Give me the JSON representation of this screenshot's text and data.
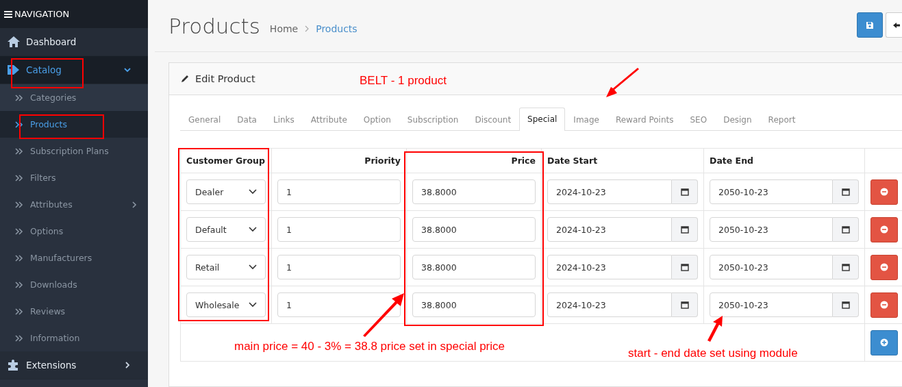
{
  "sidebar": {
    "title": "NAVIGATION",
    "items": [
      {
        "label": "Dashboard",
        "selected": false
      },
      {
        "label": "Catalog",
        "selected": true,
        "expanded": true,
        "children": [
          {
            "label": "Categories",
            "selected": false,
            "has_submenu": false
          },
          {
            "label": "Products",
            "selected": true,
            "has_submenu": false
          },
          {
            "label": "Subscription Plans",
            "selected": false,
            "has_submenu": false
          },
          {
            "label": "Filters",
            "selected": false,
            "has_submenu": false
          },
          {
            "label": "Attributes",
            "selected": false,
            "has_submenu": true
          },
          {
            "label": "Options",
            "selected": false,
            "has_submenu": false
          },
          {
            "label": "Manufacturers",
            "selected": false,
            "has_submenu": false
          },
          {
            "label": "Downloads",
            "selected": false,
            "has_submenu": false
          },
          {
            "label": "Reviews",
            "selected": false,
            "has_submenu": false
          },
          {
            "label": "Information",
            "selected": false,
            "has_submenu": false
          }
        ]
      },
      {
        "label": "Extensions",
        "selected": false,
        "expanded": false
      }
    ]
  },
  "page": {
    "title": "Products",
    "breadcrumb": [
      {
        "label": "Home",
        "selected": false
      },
      {
        "label": "Products",
        "selected": true
      }
    ]
  },
  "panel": {
    "title": "Edit Product"
  },
  "tabs": [
    {
      "label": "General",
      "selected": false
    },
    {
      "label": "Data",
      "selected": false
    },
    {
      "label": "Links",
      "selected": false
    },
    {
      "label": "Attribute",
      "selected": false
    },
    {
      "label": "Option",
      "selected": false
    },
    {
      "label": "Subscription",
      "selected": false
    },
    {
      "label": "Discount",
      "selected": false
    },
    {
      "label": "Special",
      "selected": true
    },
    {
      "label": "Image",
      "selected": false
    },
    {
      "label": "Reward Points",
      "selected": false
    },
    {
      "label": "SEO",
      "selected": false
    },
    {
      "label": "Design",
      "selected": false
    },
    {
      "label": "Report",
      "selected": false
    }
  ],
  "table": {
    "columns": [
      "Customer Group",
      "Priority",
      "Price",
      "Date Start",
      "Date End"
    ],
    "rows": [
      {
        "customer_group": "Dealer",
        "priority": "1",
        "price": "38.8000",
        "date_start": "2024-10-23",
        "date_end": "2050-10-23"
      },
      {
        "customer_group": "Default",
        "priority": "1",
        "price": "38.8000",
        "date_start": "2024-10-23",
        "date_end": "2050-10-23"
      },
      {
        "customer_group": "Retail",
        "priority": "1",
        "price": "38.8000",
        "date_start": "2024-10-23",
        "date_end": "2050-10-23"
      },
      {
        "customer_group": "Wholesale",
        "priority": "1",
        "price": "38.8000",
        "date_start": "2024-10-23",
        "date_end": "2050-10-23"
      }
    ]
  },
  "annotations": [
    {
      "kind": "note",
      "text": "BELT - 1 product"
    },
    {
      "kind": "note",
      "text": "main price = 40 - 3% = 38.8 price set in special price"
    },
    {
      "kind": "note",
      "text": "start - end date set using module"
    }
  ]
}
